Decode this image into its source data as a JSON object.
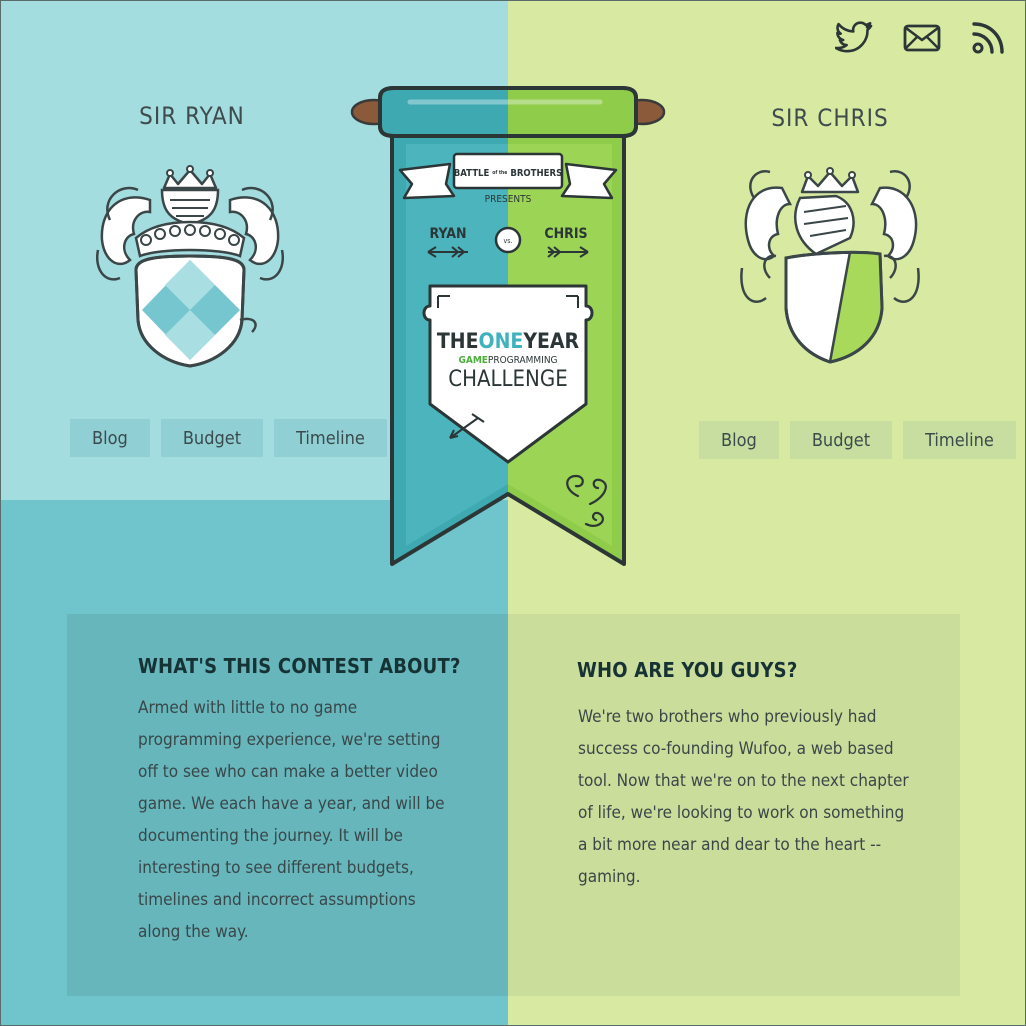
{
  "social": {
    "twitter_icon": "twitter-icon",
    "mail_icon": "mail-icon",
    "rss_icon": "rss-icon"
  },
  "left": {
    "name": "SIR RYAN",
    "tabs": [
      "Blog",
      "Budget",
      "Timeline"
    ]
  },
  "right": {
    "name": "SIR CHRIS",
    "tabs": [
      "Blog",
      "Budget",
      "Timeline"
    ]
  },
  "banner": {
    "brand_line1": "BATTLE",
    "brand_of_the": "of the",
    "brand_line2": "BROTHERS",
    "presents": "PRESENTS",
    "player1": "RYAN",
    "vs": "vs.",
    "player2": "CHRIS",
    "title_the": "THE",
    "title_one": "ONE",
    "title_year": "YEAR",
    "sub_game": "GAME",
    "sub_programming": "PROGRAMMING",
    "challenge": "CHALLENGE"
  },
  "about": {
    "title": "WHAT'S THIS CONTEST ABOUT?",
    "lines": [
      "Armed with little to no game",
      "programming experience, we're setting",
      "off to see who can make a better video",
      "game. We each have a year, and will be",
      "documenting the journey. It will be",
      "interesting to see different budgets,",
      "timelines and incorrect assumptions",
      "along the way."
    ]
  },
  "who": {
    "title": "WHO ARE YOU GUYS?",
    "lines": [
      "We're two brothers who previously had",
      "success co-founding Wufoo, a web based",
      "tool. Now that we're on to the next chapter",
      "of life, we're looking to work on something",
      "a bit more near and dear to the heart --",
      "gaming."
    ]
  },
  "colors": {
    "ryan_light": "#a4dde0",
    "ryan_dark": "#70c4cb",
    "chris": "#d8eaa2",
    "ink": "#3b4a4c"
  }
}
